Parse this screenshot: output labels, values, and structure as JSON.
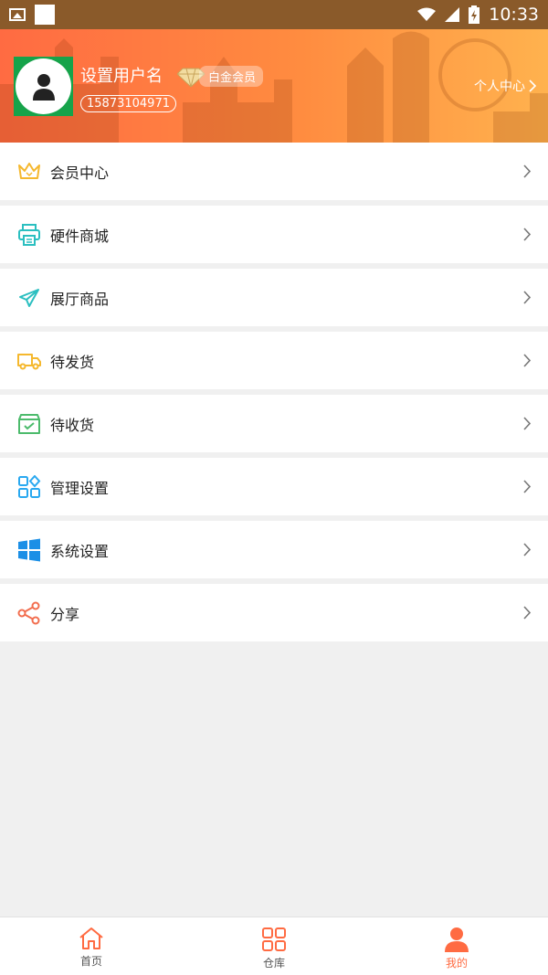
{
  "status_bar": {
    "time": "10:33"
  },
  "profile": {
    "username": "设置用户名",
    "membership": "白金会员",
    "phone": "15873104971",
    "center_link": "个人中心"
  },
  "menu": [
    {
      "label": "会员中心",
      "icon": "crown-icon"
    },
    {
      "label": "硬件商城",
      "icon": "printer-icon"
    },
    {
      "label": "展厅商品",
      "icon": "paper-plane-icon"
    },
    {
      "label": "待发货",
      "icon": "truck-icon"
    },
    {
      "label": "待收货",
      "icon": "inbox-check-icon"
    },
    {
      "label": "管理设置",
      "icon": "apps-grid-icon"
    },
    {
      "label": "系统设置",
      "icon": "windows-icon"
    },
    {
      "label": "分享",
      "icon": "share-icon"
    }
  ],
  "tabs": [
    {
      "label": "首页",
      "icon": "home-icon"
    },
    {
      "label": "仓库",
      "icon": "warehouse-grid-icon"
    },
    {
      "label": "我的",
      "icon": "user-icon",
      "active": true
    }
  ],
  "colors": {
    "accent": "#ff6b42",
    "header_start": "#ff6b42",
    "header_end": "#ffb24e"
  }
}
